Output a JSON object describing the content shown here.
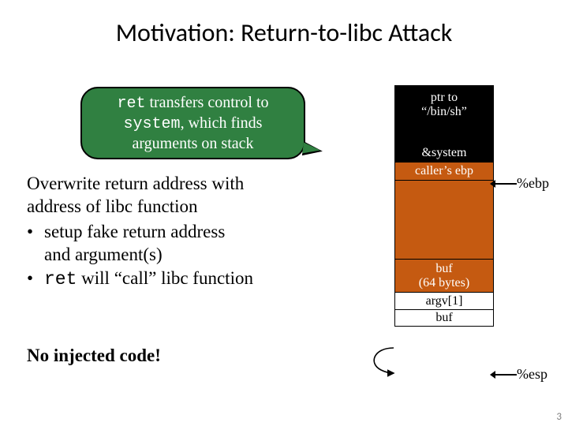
{
  "title": "Motivation: Return-to-libc Attack",
  "callout": {
    "line1a": "ret",
    "line1b": " transfers control to",
    "line2a": "system",
    "line2b": ", which finds",
    "line3": "arguments on stack"
  },
  "body": {
    "l1": "Overwrite return address with",
    "l2": "address of libc function",
    "b1a": "setup fake return address",
    "b1b": "and argument(s)",
    "b2a": "ret",
    "b2b": " will “call” libc function"
  },
  "noCode": "No injected code!",
  "stack": {
    "ptr_l1": "ptr to",
    "ptr_l2": "“/bin/sh”",
    "blank": "",
    "system": "&system",
    "ebp": "caller’s ebp",
    "mid": "",
    "buf_l1": "buf",
    "buf_l2": "(64 bytes)",
    "argv": "argv[1]",
    "buf2": "buf"
  },
  "regs": {
    "ebp": "%ebp",
    "esp": "%esp"
  },
  "pageNum": "3"
}
